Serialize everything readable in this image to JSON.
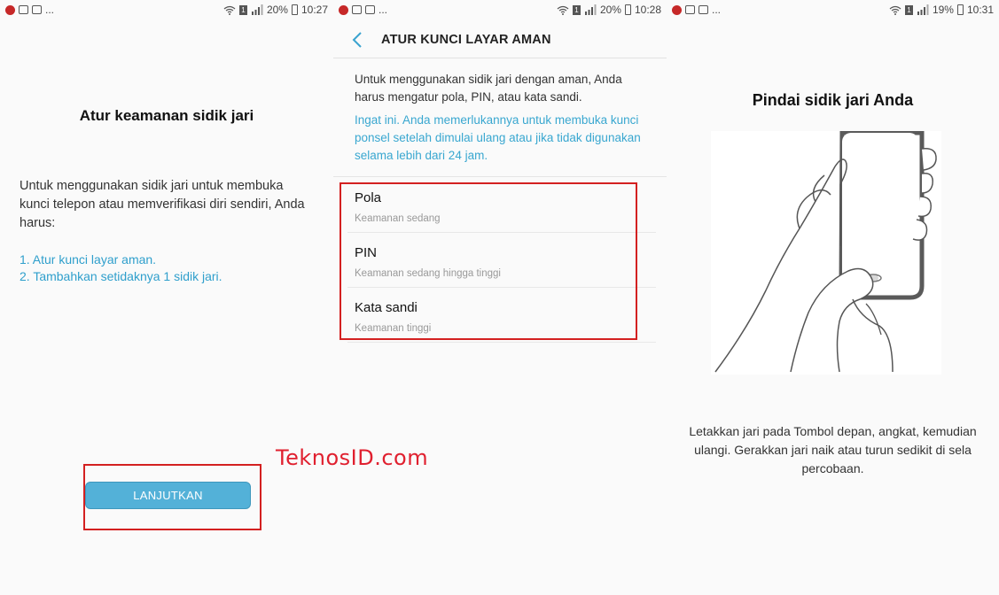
{
  "watermark": "TeknosID.com",
  "screens": [
    {
      "status": {
        "dots": "...",
        "battery": "20%",
        "time": "10:27"
      },
      "title": "Atur keamanan sidik jari",
      "body": "Untuk menggunakan sidik jari untuk membuka kunci telepon atau memverifikasi diri sendiri, Anda harus:",
      "steps": [
        "1. Atur kunci layar aman.",
        "2. Tambahkan setidaknya 1 sidik jari."
      ],
      "button_label": "LANJUTKAN"
    },
    {
      "status": {
        "dots": "...",
        "battery": "20%",
        "time": "10:28"
      },
      "title": "ATUR KUNCI LAYAR AMAN",
      "info": "Untuk menggunakan sidik jari dengan aman, Anda harus mengatur pola, PIN, atau kata sandi.",
      "note": "Ingat ini. Anda memerlukannya untuk membuka kunci ponsel setelah dimulai ulang atau jika tidak digunakan selama lebih dari 24 jam.",
      "options": [
        {
          "title": "Pola",
          "subtitle": "Keamanan sedang"
        },
        {
          "title": "PIN",
          "subtitle": "Keamanan sedang hingga tinggi"
        },
        {
          "title": "Kata sandi",
          "subtitle": "Keamanan tinggi"
        }
      ]
    },
    {
      "status": {
        "dots": "...",
        "battery": "19%",
        "time": "10:31"
      },
      "title": "Pindai sidik jari Anda",
      "instruction": "Letakkan jari pada Tombol depan, angkat, kemudian ulangi. Gerakkan jari naik atau turun sedikit di sela percobaan."
    }
  ],
  "colors": {
    "accent": "#53b1d8",
    "link": "#2f9fcc",
    "highlight": "#d32020",
    "watermark": "#e0202f"
  },
  "icons": [
    "back-arrow-icon",
    "wifi-icon",
    "signal-icon",
    "battery-icon",
    "notification-icon"
  ]
}
